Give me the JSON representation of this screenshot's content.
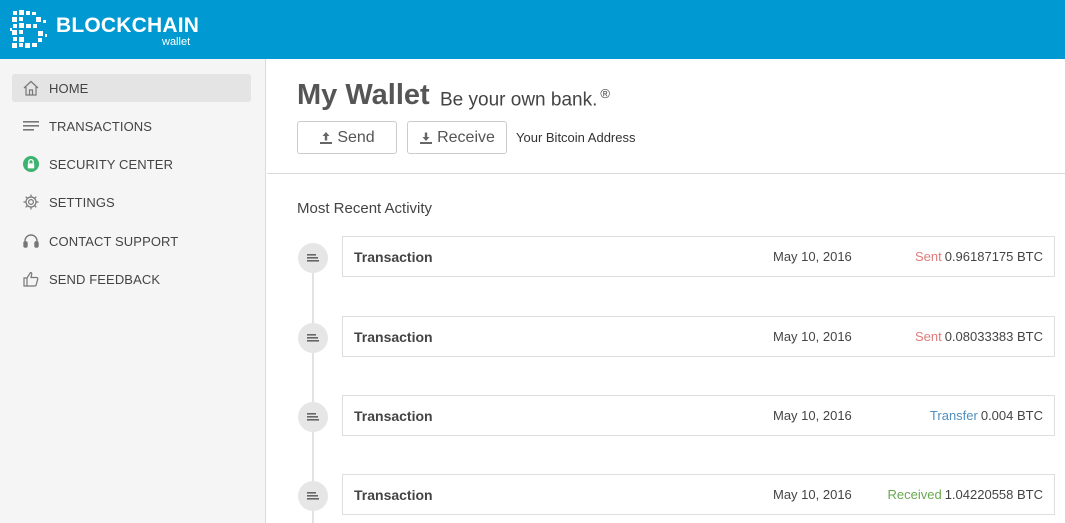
{
  "header": {
    "brand": "BLOCKCHAIN",
    "brand_sub": "wallet",
    "colors": {
      "bar": "#0099d1"
    }
  },
  "sidebar": {
    "items": [
      {
        "label": "HOME",
        "icon": "home-icon",
        "active": true
      },
      {
        "label": "TRANSACTIONS",
        "icon": "transactions-icon"
      },
      {
        "label": "SECURITY CENTER",
        "icon": "lock-icon"
      },
      {
        "label": "SETTINGS",
        "icon": "gear-icon"
      },
      {
        "label": "CONTACT SUPPORT",
        "icon": "headset-icon"
      },
      {
        "label": "SEND FEEDBACK",
        "icon": "thumbs-up-icon"
      }
    ]
  },
  "main": {
    "title": "My Wallet",
    "tagline": "Be your own bank.",
    "tagline_mark": "®",
    "send_label": "Send",
    "receive_label": "Receive",
    "address_label": "Your Bitcoin Address",
    "activity_title": "Most Recent Activity"
  },
  "transactions": [
    {
      "title": "Transaction",
      "date": "May 10, 2016",
      "status": "Sent",
      "amount": "0.96187175 BTC",
      "status_color": "#e07b7b"
    },
    {
      "title": "Transaction",
      "date": "May 10, 2016",
      "status": "Sent",
      "amount": "0.08033383 BTC",
      "status_color": "#e07b7b"
    },
    {
      "title": "Transaction",
      "date": "May 10, 2016",
      "status": "Transfer",
      "amount": "0.004 BTC",
      "status_color": "#4f8fc0"
    },
    {
      "title": "Transaction",
      "date": "May 10, 2016",
      "status": "Received",
      "amount": "1.04220558 BTC",
      "status_color": "#6aa84f"
    }
  ]
}
